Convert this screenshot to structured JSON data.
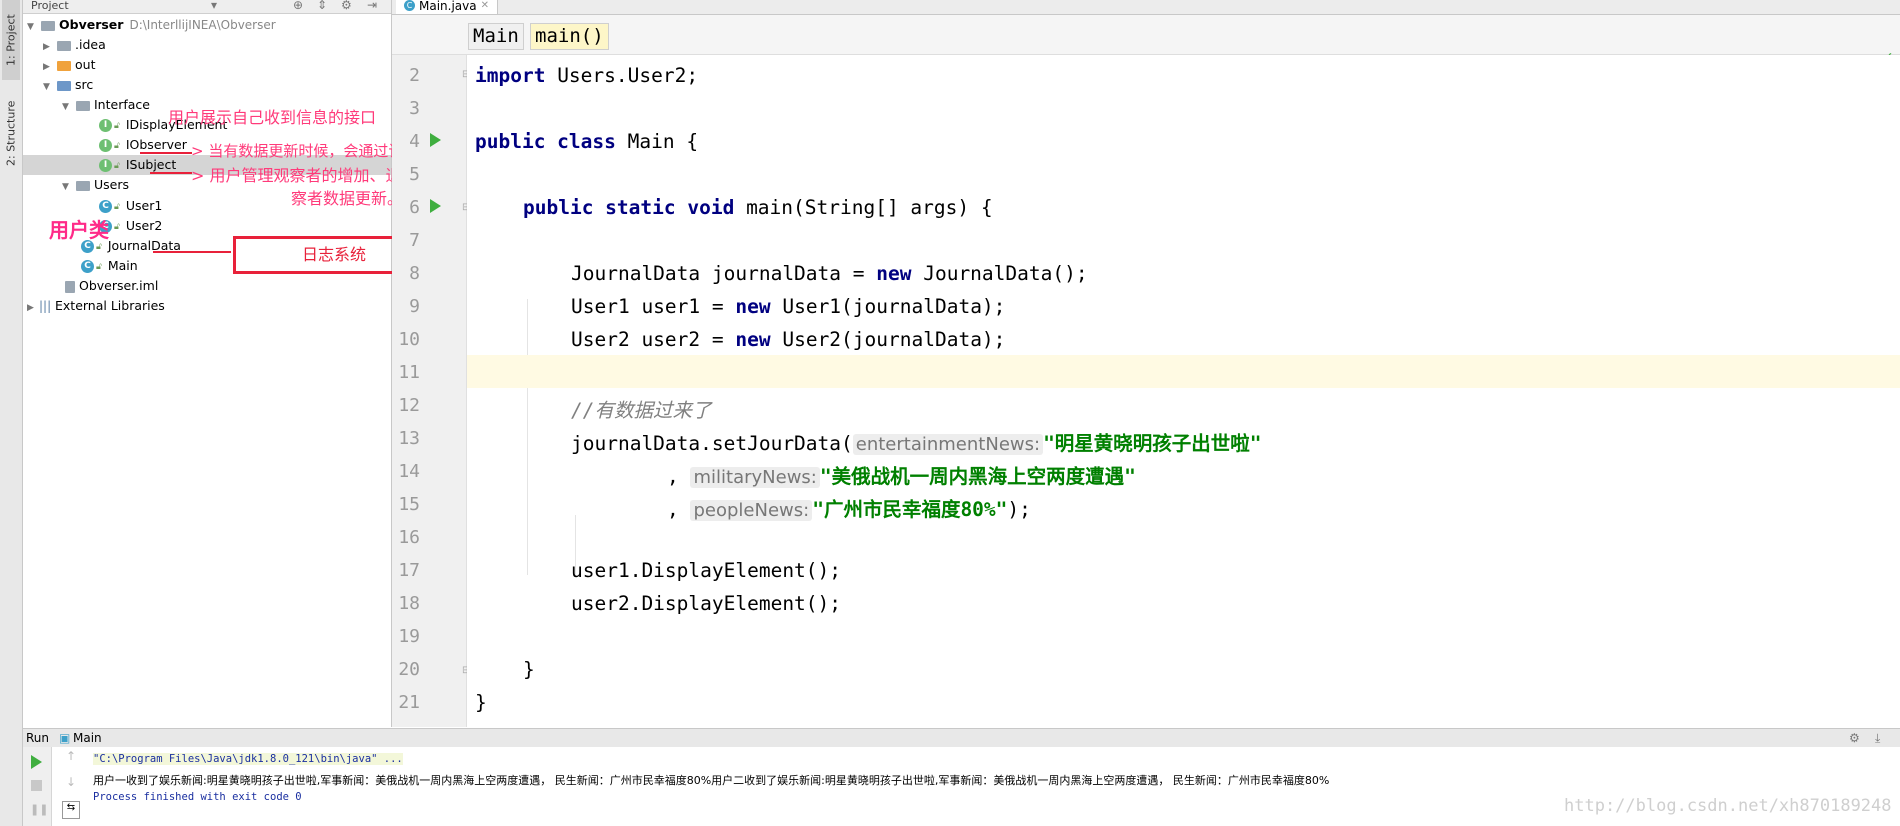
{
  "sidebar": {
    "project_tab": "1: Project",
    "structure_tab": "2: Structure"
  },
  "project_panel": {
    "title": "Project",
    "tree": {
      "root_name": "Obverser",
      "root_path": "D:\\InterllijINEA\\Obverser",
      "idea": ".idea",
      "out": "out",
      "src": "src",
      "interface": "Interface",
      "idisplay": "IDisplayElement",
      "iobserver": "IObserver",
      "isubject": "ISubject",
      "users": "Users",
      "user1": "User1",
      "user2": "User2",
      "journal": "JournalData",
      "main": "Main",
      "iml": "Obverser.iml",
      "ext": "External Libraries"
    }
  },
  "annotations": {
    "display_iface": "用户展示自己收到信息的接口",
    "observer_note": "当有数据更新时候，会通过该接口来传递数据。",
    "subject_note_1": "用户管理观察者的增加、退出和通知观",
    "subject_note_2": "察者数据更新。",
    "user_class": "用户类",
    "log_system": "日志系统"
  },
  "editor": {
    "tab_label": "Main.java",
    "breadcrumb_class": "Main",
    "breadcrumb_method": "main()",
    "line_numbers": [
      "2",
      "3",
      "4",
      "5",
      "6",
      "7",
      "8",
      "9",
      "10",
      "11",
      "12",
      "13",
      "14",
      "15",
      "16",
      "17",
      "18",
      "19",
      "20",
      "21"
    ],
    "code": {
      "l2_kw": "import",
      "l2_rest": " Users.User2;",
      "l4_kw": "public class",
      "l4_rest": " Main {",
      "l6_kw": "public static void",
      "l6_rest": " main(String[] args) {",
      "l8_a": "JournalData journalData = ",
      "l8_kw": "new",
      "l8_b": " JournalData();",
      "l9_a": "User1 user1 = ",
      "l9_kw": "new",
      "l9_b": " User1(journalData);",
      "l10_a": "User2 user2 = ",
      "l10_kw": "new",
      "l10_b": " User2(journalData);",
      "l12_comment": "//有数据过来了",
      "l13_a": "journalData.setJourData(",
      "l13_hint": "entertainmentNews:",
      "l13_str": "\"明星黄晓明孩子出世啦\"",
      "l14_a": ", ",
      "l14_hint": "militaryNews:",
      "l14_str": "\"美俄战机一周内黑海上空两度遭遇\"",
      "l15_a": ", ",
      "l15_hint": "peopleNews:",
      "l15_str": "\"广州市民幸福度80%\"",
      "l15_b": ");",
      "l17": "user1.DisplayElement();",
      "l18": "user2.DisplayElement();",
      "l20": "}",
      "l21": "}"
    }
  },
  "run_panel": {
    "label": "Run",
    "config": "Main",
    "cmd": "\"C:\\Program Files\\Java\\jdk1.8.0_121\\bin\\java\" ...",
    "output": "用户一收到了娱乐新闻:明星黄晓明孩子出世啦,军事新闻：美俄战机一周内黑海上空两度遭遇， 民生新闻：广州市民幸福度80%用户二收到了娱乐新闻:明星黄晓明孩子出世啦,军事新闻：美俄战机一周内黑海上空两度遭遇， 民生新闻：广州市民幸福度80%",
    "exit": "Process finished with exit code 0"
  },
  "watermark": "http://blog.csdn.net/xh870189248"
}
